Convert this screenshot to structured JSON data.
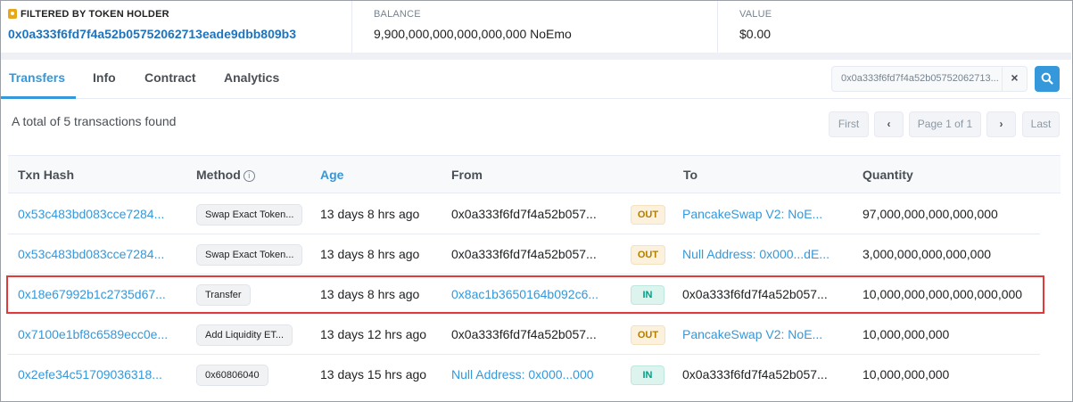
{
  "summary": {
    "filter_label": "FILTERED BY TOKEN HOLDER",
    "filter_address": "0x0a333f6fd7f4a52b05752062713eade9dbb809b3",
    "balance_label": "BALANCE",
    "balance_value": "9,900,000,000,000,000,000 NoEmo",
    "value_label": "VALUE",
    "value_amount": "$0.00"
  },
  "tabs": [
    "Transfers",
    "Info",
    "Contract",
    "Analytics"
  ],
  "active_tab": "Transfers",
  "filter": {
    "text": "0x0a333f6fd7f4a52b05752062713...",
    "clear": "×"
  },
  "total_text": "A total of 5 transactions found",
  "pager": {
    "first": "First",
    "prev": "‹",
    "page": "Page 1 of 1",
    "next": "›",
    "last": "Last"
  },
  "table": {
    "headers": {
      "txn_hash": "Txn Hash",
      "method": "Method",
      "age": "Age",
      "from": "From",
      "to": "To",
      "quantity": "Quantity"
    },
    "rows": [
      {
        "hash": "0x53c483bd083cce7284...",
        "method": "Swap Exact Token...",
        "age": "13 days 8 hrs ago",
        "from": "0x0a333f6fd7f4a52b057...",
        "direction": "OUT",
        "to": "PancakeSwap V2: NoE...",
        "quantity": "97,000,000,000,000,000"
      },
      {
        "hash": "0x53c483bd083cce7284...",
        "method": "Swap Exact Token...",
        "age": "13 days 8 hrs ago",
        "from": "0x0a333f6fd7f4a52b057...",
        "direction": "OUT",
        "to": "Null Address: 0x000...dE...",
        "quantity": "3,000,000,000,000,000"
      },
      {
        "hash": "0x18e67992b1c2735d67...",
        "method": "Transfer",
        "age": "13 days 8 hrs ago",
        "from": "0x8ac1b3650164b092c6...",
        "direction": "IN",
        "to": "0x0a333f6fd7f4a52b057...",
        "quantity": "10,000,000,000,000,000,000"
      },
      {
        "hash": "0x7100e1bf8c6589ecc0e...",
        "method": "Add Liquidity ET...",
        "age": "13 days 12 hrs ago",
        "from": "0x0a333f6fd7f4a52b057...",
        "direction": "OUT",
        "to": "PancakeSwap V2: NoE...",
        "quantity": "10,000,000,000"
      },
      {
        "hash": "0x2efe34c51709036318...",
        "method": "0x60806040",
        "age": "13 days 15 hrs ago",
        "from": "Null Address: 0x000...000",
        "direction": "IN",
        "to": "0x0a333f6fd7f4a52b057...",
        "quantity": "10,000,000,000"
      }
    ]
  },
  "colors": {
    "accent": "#3498db",
    "highlight_border": "#e03b3b",
    "out_badge": "#b47d00",
    "in_badge": "#00a186"
  }
}
